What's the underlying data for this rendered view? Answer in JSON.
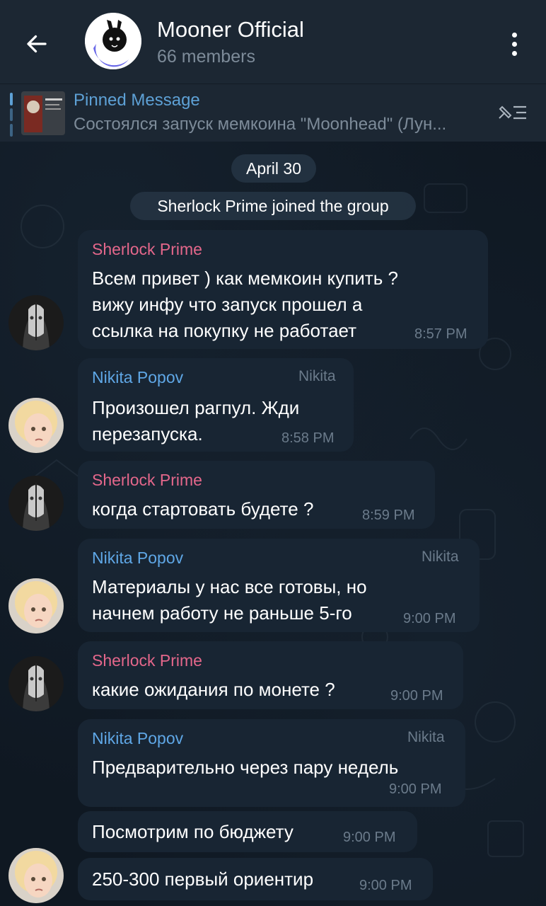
{
  "header": {
    "title": "Mooner Official",
    "subtitle": "66 members"
  },
  "pinned": {
    "title": "Pinned Message",
    "text": "Состоялся запуск мемкоина \"Moonhead\" (Лун..."
  },
  "date_pill": "April 30",
  "service_pill": "Sherlock Prime joined the group",
  "messages": [
    {
      "sender": "Sherlock Prime",
      "text": "Всем привет ) как мемкоин купить ?\nвижу инфу что запуск прошел а\nссылка на покупку не работает",
      "time": "8:57 PM"
    },
    {
      "sender": "Nikita Popov",
      "role": "Nikita",
      "text": "Произошел рагпул. Жди\nперезапуска.",
      "time": "8:58 PM"
    },
    {
      "sender": "Sherlock Prime",
      "text": "когда стартовать будете ?",
      "time": "8:59 PM"
    },
    {
      "sender": "Nikita Popov",
      "role": "Nikita",
      "text": "Материалы у нас все готовы, но\nначнем работу не раньше 5-го",
      "time": "9:00 PM"
    },
    {
      "sender": "Sherlock Prime",
      "text": "какие ожидания по монете ?",
      "time": "9:00 PM"
    },
    {
      "sender": "Nikita Popov",
      "role": "Nikita",
      "text": "Предварительно через пару недель",
      "time": "9:00 PM"
    },
    {
      "text": "Посмотрим по бюджету",
      "time": "9:00 PM"
    },
    {
      "text": "250-300 первый ориентир",
      "time": "9:00 PM"
    }
  ],
  "icons": {
    "back": "arrow-left-icon",
    "menu": "more-vertical-icon",
    "pinned_list": "pinned-list-icon"
  },
  "colors": {
    "header_bg": "#1c2733",
    "bubble_bg": "#182533",
    "sherlock_name": "#e4678b",
    "nikita_name": "#5fa7e6",
    "pinned_accent": "#5ea1d6"
  }
}
